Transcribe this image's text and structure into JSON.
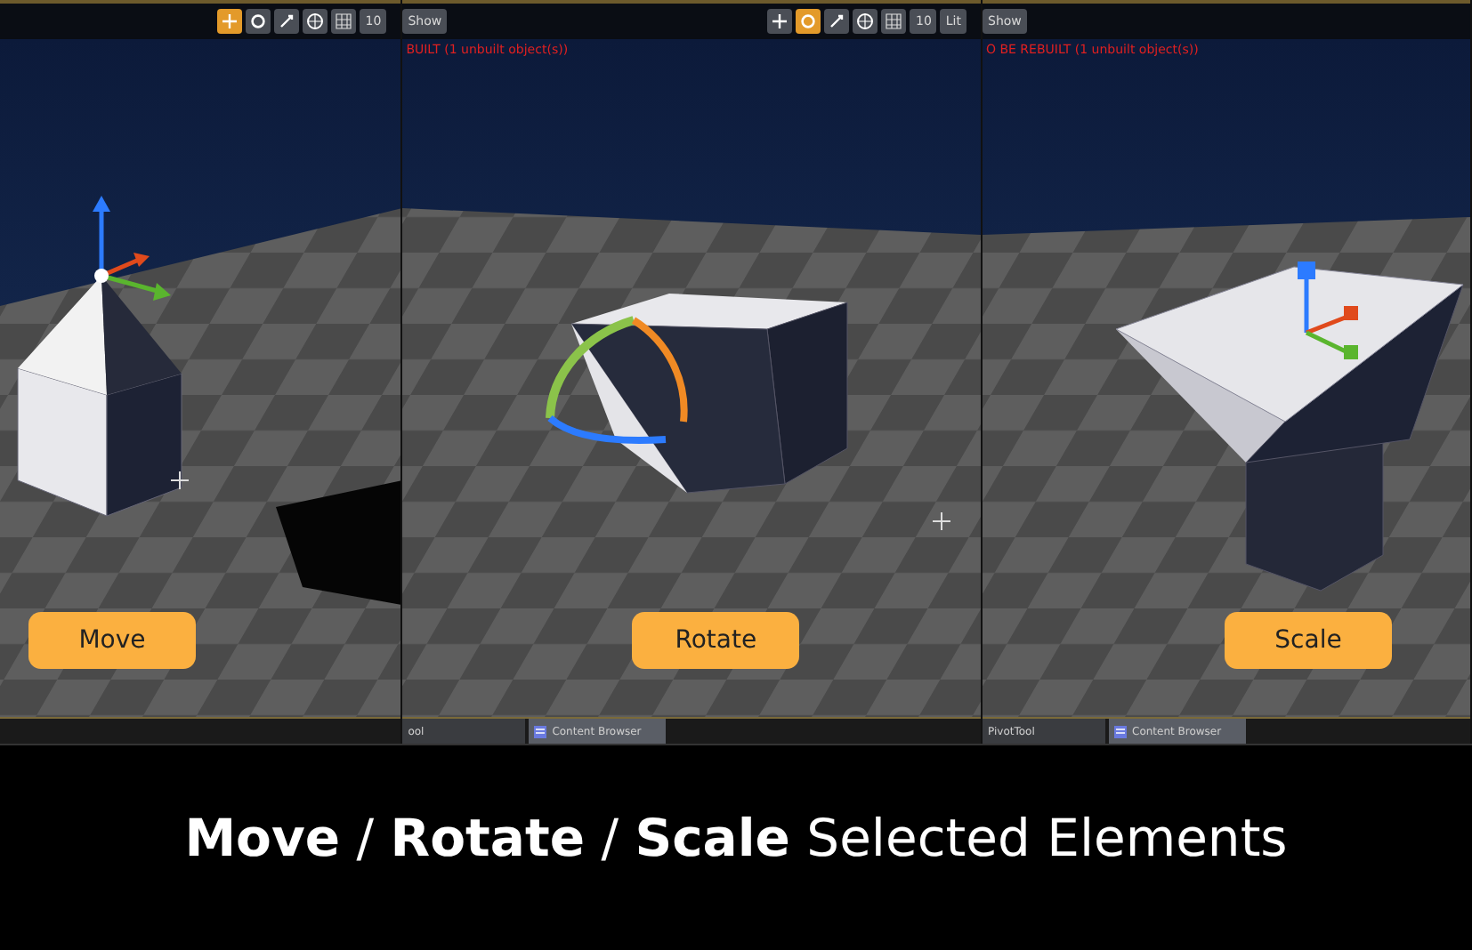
{
  "panels": [
    {
      "kind": "move",
      "tools": [
        {
          "selected": true
        },
        {
          "selected": false
        },
        {
          "selected": false
        }
      ],
      "grid_value": "10",
      "action": "Move"
    },
    {
      "kind": "rotate",
      "show_button": "Show",
      "notice": "BUILT (1 unbuilt object(s))",
      "tools": [
        {
          "selected": false
        },
        {
          "selected": true
        },
        {
          "selected": false
        }
      ],
      "grid_value": "10",
      "view_mode": "Lit",
      "action": "Rotate",
      "tabs": [
        {
          "kind": "tool",
          "label": "ool"
        },
        {
          "kind": "browser",
          "label": "Content Browser"
        }
      ]
    },
    {
      "kind": "scale",
      "show_button": "Show",
      "notice": "O BE REBUILT (1 unbuilt object(s))",
      "action": "Scale",
      "tabs": [
        {
          "kind": "tool",
          "label": "PivotTool"
        },
        {
          "kind": "browser",
          "label": "Content Browser"
        }
      ]
    }
  ],
  "caption": "**Move** / **Rotate** / **Scale** Selected Elements"
}
